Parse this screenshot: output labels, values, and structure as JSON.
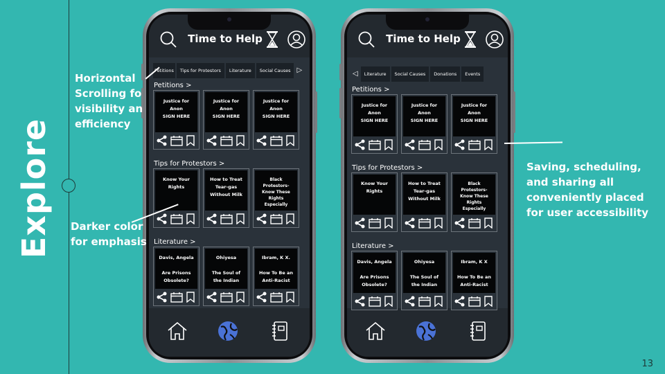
{
  "slide": {
    "heading": "Explore",
    "page_number": "13",
    "annotations": {
      "left_top": "Horizontal\nScrolling fo\nvisibility an\nefficiency",
      "left_bottom": "Darker color\nfor emphasis",
      "right": "Saving, scheduling,\nand sharing all\nconveniently placed\nfor user accessibility"
    }
  },
  "colors": {
    "slide_background": "#33b7b0",
    "screen_background": "#2a323a",
    "card_inner": "#050607",
    "globe_accent": "#4a72d6"
  },
  "phone_left": {
    "title": "Time to Help",
    "tabs": [
      "Petitions",
      "Tips for Protestors",
      "Literature",
      "Social Causes"
    ],
    "tab_arrow": "▷",
    "sections": [
      {
        "label": "Petitions  >",
        "cards": [
          "Justice for\nAnon\nSIGN HERE",
          "Justice for\nAnon\nSIGN HERE",
          "Justice for\nAnon\nSIGN HERE"
        ]
      },
      {
        "label": "Tips for Protestors  >",
        "cards": [
          "Know Your\nRights",
          "How to Treat\nTear-gas\nWithout Milk",
          "Black\nProtestors-\nKnow These\nRights\nEspecially"
        ]
      },
      {
        "label": "Literature  >",
        "cards": [
          "Davis, Angela\n\nAre Prisons\nObsolete?",
          "Ohiyesa\n\nThe Soul of\nthe Indian",
          "Ibram, K X.\n\nHow To Be an\nAnti-Racist"
        ]
      }
    ]
  },
  "phone_right": {
    "title": "Time to Help",
    "tab_arrow": "◁",
    "tabs": [
      "Literature",
      "Social Causes",
      "Donations",
      "Events"
    ],
    "sections": [
      {
        "label": "Petitions  >",
        "cards": [
          "Justice for\nAnon\nSIGN HERE",
          "Justice for\nAnon\nSIGN HERE",
          "Justice for\nAnon\nSIGN HERE"
        ]
      },
      {
        "label": "Tips for Protestors  >",
        "cards": [
          "Know Your\nRights",
          "How to Treat\nTear-gas\nWithout Milk",
          "Black\nProtestors-\nKnow These\nRights\nEspecially"
        ]
      },
      {
        "label": "Literature  >",
        "cards": [
          "Davis, Angela\n\nAre Prisons\nObsolete?",
          "Ohiyesa\n\nThe Soul of\nthe Indian",
          "Ibram, K X\n\nHow To Be an\nAnti-Racist"
        ]
      }
    ]
  },
  "icons": {
    "top_bar": [
      "search-icon",
      "hourglass-icon",
      "profile-icon"
    ],
    "card_actions": [
      "share-icon",
      "calendar-icon",
      "bookmark-icon"
    ],
    "bottom_nav": [
      "home-icon",
      "globe-icon",
      "notebook-icon"
    ]
  }
}
